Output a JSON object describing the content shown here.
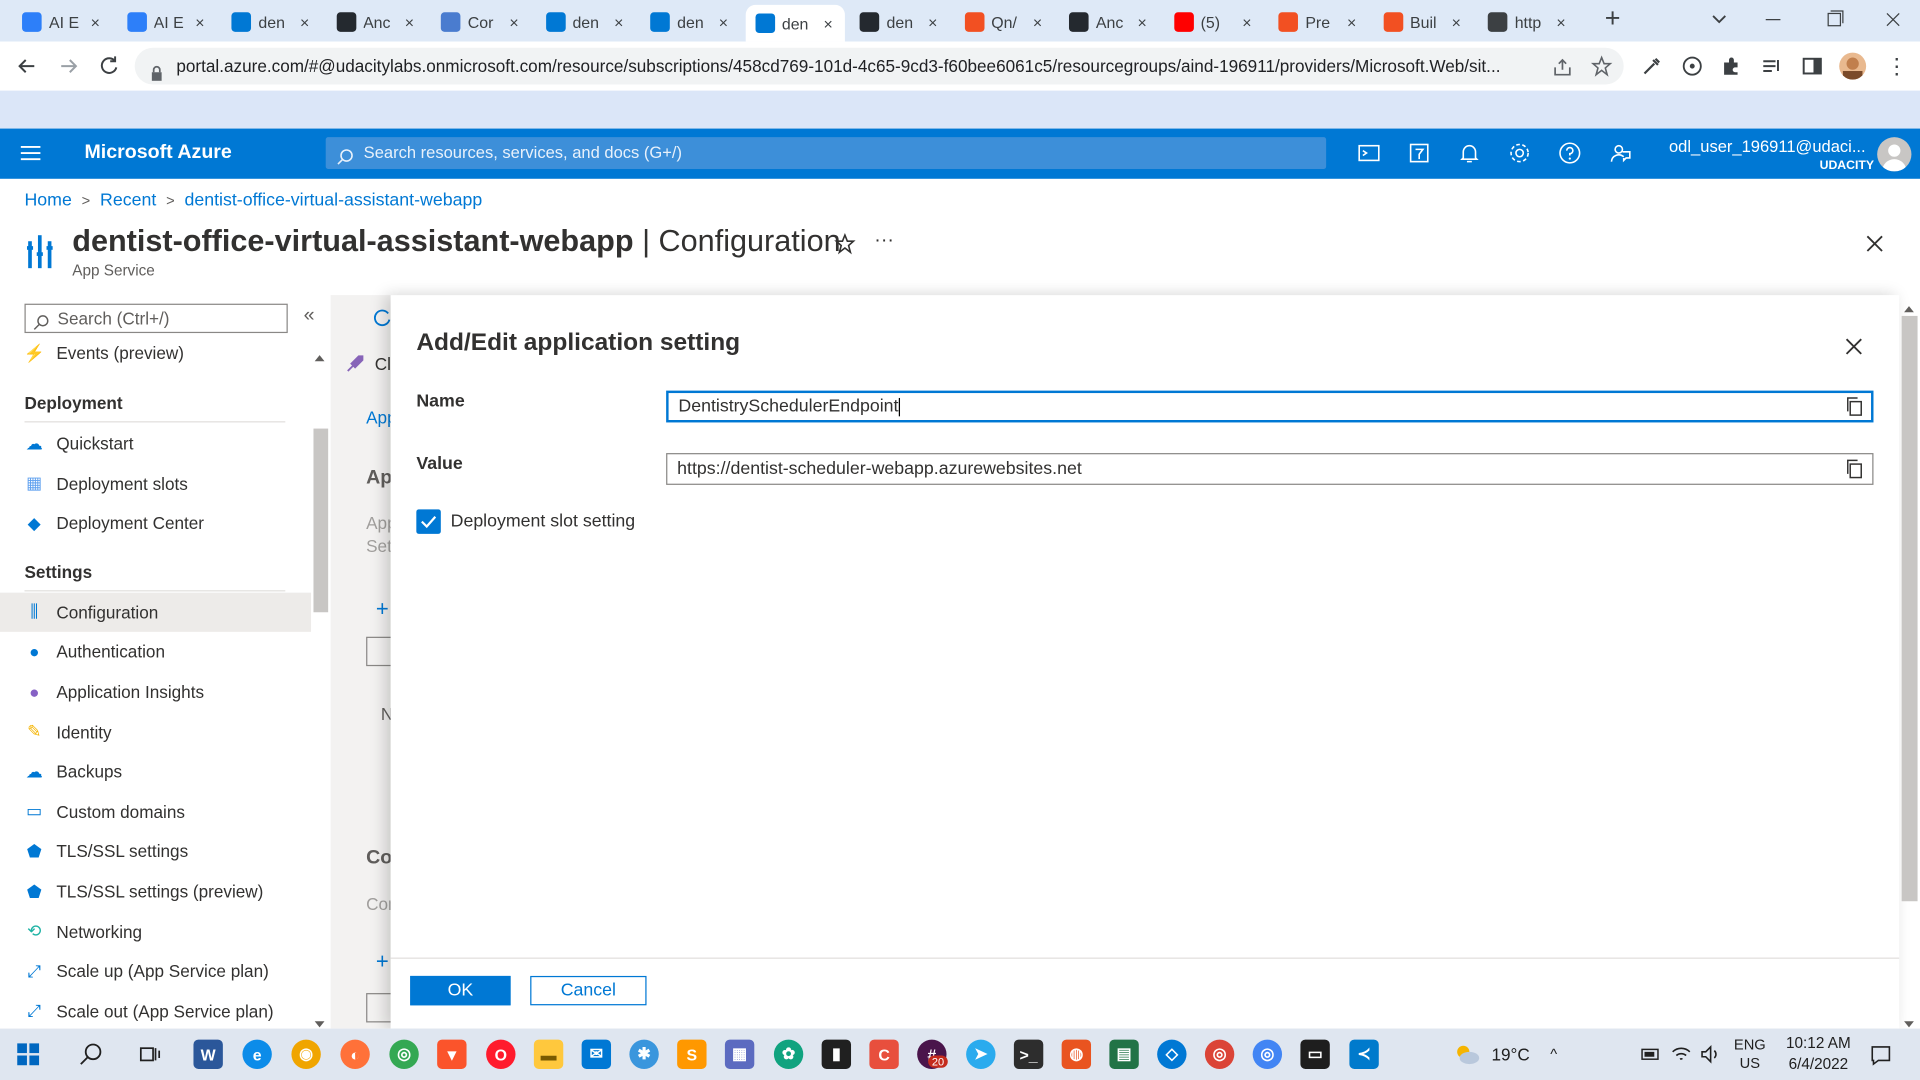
{
  "browser": {
    "tabs": [
      {
        "label": "AI E",
        "icon": "udacity-icon",
        "color": "#2d7ff9"
      },
      {
        "label": "AI E",
        "icon": "udacity-icon",
        "color": "#2d7ff9"
      },
      {
        "label": "den",
        "icon": "azure-icon",
        "color": "#0078d4"
      },
      {
        "label": "Anc",
        "icon": "github-icon",
        "color": "#24292f"
      },
      {
        "label": "Cor",
        "icon": "bot-icon",
        "color": "#4a7ccf"
      },
      {
        "label": "den",
        "icon": "azure-icon",
        "color": "#0078d4"
      },
      {
        "label": "den",
        "icon": "azure-icon",
        "color": "#0078d4"
      },
      {
        "label": "den",
        "icon": "azure-icon",
        "color": "#0078d4"
      },
      {
        "label": "den",
        "icon": "github-icon",
        "color": "#24292f"
      },
      {
        "label": "Qn/",
        "icon": "microsoft-icon",
        "color": "#f25022"
      },
      {
        "label": "Anc",
        "icon": "github-icon",
        "color": "#24292f"
      },
      {
        "label": "(5) ",
        "icon": "youtube-icon",
        "color": "#ff0000"
      },
      {
        "label": "Pre",
        "icon": "microsoft-icon",
        "color": "#f25022"
      },
      {
        "label": "Buil",
        "icon": "microsoft-icon",
        "color": "#f25022"
      },
      {
        "label": "http",
        "icon": "globe-icon",
        "color": "#3c4043"
      }
    ],
    "tab_close": "×",
    "new_tab": "+",
    "url": "portal.azure.com/#@udacitylabs.onmicrosoft.com/resource/subscriptions/458cd769-101d-4c65-9cd3-f60bee6061c5/resourcegroups/aind-196911/providers/Microsoft.Web/sit..."
  },
  "azure": {
    "brand": "Microsoft Azure",
    "search_placeholder": "Search resources, services, and docs (G+/)",
    "user_name": "odl_user_196911@udaci...",
    "user_tenant": "UDACITY"
  },
  "breadcrumb": [
    "Home",
    "Recent",
    "dentist-office-virtual-assistant-webapp"
  ],
  "page": {
    "title_main": "dentist-office-virtual-assistant-webapp",
    "title_sep": " | ",
    "title_section": "Configuration",
    "subtitle": "App Service",
    "more": "···"
  },
  "sidebar": {
    "search_placeholder": "Search (Ctrl+/)",
    "collapse": "«",
    "top_item": {
      "label": "Events (preview)",
      "icon": "lightning-icon"
    },
    "sections": [
      {
        "heading": "Deployment",
        "items": [
          {
            "label": "Quickstart",
            "icon": "cloud-icon"
          },
          {
            "label": "Deployment slots",
            "icon": "slots-icon"
          },
          {
            "label": "Deployment Center",
            "icon": "cube-icon"
          }
        ]
      },
      {
        "heading": "Settings",
        "items": [
          {
            "label": "Configuration",
            "icon": "config-icon",
            "selected": true
          },
          {
            "label": "Authentication",
            "icon": "person-icon"
          },
          {
            "label": "Application Insights",
            "icon": "insights-icon"
          },
          {
            "label": "Identity",
            "icon": "key-icon"
          },
          {
            "label": "Backups",
            "icon": "backup-icon"
          },
          {
            "label": "Custom domains",
            "icon": "domain-icon"
          },
          {
            "label": "TLS/SSL settings",
            "icon": "shield-icon"
          },
          {
            "label": "TLS/SSL settings (preview)",
            "icon": "shield-icon"
          },
          {
            "label": "Networking",
            "icon": "network-icon"
          },
          {
            "label": "Scale up (App Service plan)",
            "icon": "scale-up-icon"
          },
          {
            "label": "Scale out (App Service plan)",
            "icon": "scale-out-icon"
          }
        ]
      }
    ]
  },
  "background": {
    "cmd_partial": "Cl",
    "tab_partial": "App",
    "heading_partial": "Ap",
    "desc1_partial": "App",
    "desc2_partial": "Set",
    "col_partial": "N",
    "conn_partial": "Co",
    "conn_desc_partial": "Con"
  },
  "dialog": {
    "title": "Add/Edit application setting",
    "name_label": "Name",
    "name_value": "DentistrySchedulerEndpoint",
    "value_label": "Value",
    "value_value": "https://dentist-scheduler-webapp.azurewebsites.net",
    "slot_label": "Deployment slot setting",
    "slot_checked": true,
    "ok_label": "OK",
    "cancel_label": "Cancel"
  },
  "taskbar": {
    "weather": "19°C",
    "lang1": "ENG",
    "lang2": "US",
    "time": "10:12 AM",
    "date": "6/4/2022",
    "badge": "20"
  },
  "colors": {
    "azure_blue": "#0078d4",
    "tab_bar": "#dee9f7",
    "taskbar": "#dfe6f0"
  }
}
